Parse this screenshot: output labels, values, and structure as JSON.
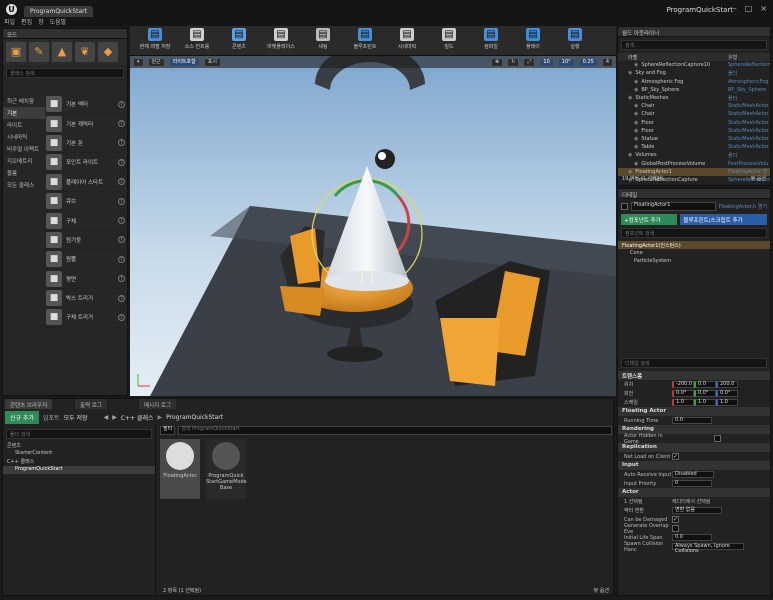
{
  "window": {
    "tabs": [
      "ProgramQuickStart"
    ],
    "project": "ProgramQuickStart",
    "menu": [
      "파일",
      "편집",
      "창",
      "도움말"
    ]
  },
  "modes": {
    "tab": "모드",
    "search_placeholder": "클래스 검색",
    "categories": [
      "최근 배치함",
      "기본",
      "라이트",
      "시네마틱",
      "비주얼 이펙트",
      "지오메트리",
      "볼륨",
      "모든 클래스"
    ],
    "selected_category": "기본",
    "items": [
      {
        "label": "기본 액터",
        "icon": "actor-icon"
      },
      {
        "label": "기본 캐릭터",
        "icon": "character-icon"
      },
      {
        "label": "기본 폰",
        "icon": "pawn-icon"
      },
      {
        "label": "포인트 라이트",
        "icon": "point-light-icon"
      },
      {
        "label": "플레이어 스타트",
        "icon": "player-start-icon"
      },
      {
        "label": "큐브",
        "icon": "cube-icon"
      },
      {
        "label": "구체",
        "icon": "sphere-icon"
      },
      {
        "label": "원기둥",
        "icon": "cylinder-icon"
      },
      {
        "label": "원뿔",
        "icon": "cone-icon"
      },
      {
        "label": "평면",
        "icon": "plane-icon"
      },
      {
        "label": "박스 트리거",
        "icon": "box-trigger-icon"
      },
      {
        "label": "구체 트리거",
        "icon": "sphere-trigger-icon"
      }
    ]
  },
  "toolbar": {
    "buttons": [
      "현재 레벨 저장",
      "소스 컨트롤",
      "콘텐츠",
      "마켓플레이스",
      "세팅",
      "블루프린트",
      "시네마틱",
      "빌드",
      "컴파일",
      "플레이",
      "실행"
    ]
  },
  "viewport": {
    "perspective": "원근",
    "lit": "라이트포함",
    "show": "표시",
    "grid_snap": "10",
    "rot_snap": "10°",
    "scale_snap": "0.25",
    "cam_speed": "4"
  },
  "outliner": {
    "tab": "월드 아웃라이너",
    "search_placeholder": "검색...",
    "col_label": "라벨",
    "col_type": "유형",
    "rows": [
      {
        "n": "SphereReflectionCapture10",
        "t": "SphereReflection",
        "d": 2
      },
      {
        "n": "Sky and Fog",
        "t": "폴더",
        "d": 1
      },
      {
        "n": "Atmospheric Fog",
        "t": "AtmosphericFog",
        "d": 2
      },
      {
        "n": "BP_Sky_Sphere",
        "t": "BP_Sky_Sphere",
        "d": 2
      },
      {
        "n": "StaticMeshes",
        "t": "폴더",
        "d": 1
      },
      {
        "n": "Chair",
        "t": "StaticMeshActor",
        "d": 2
      },
      {
        "n": "Chair",
        "t": "StaticMeshActor",
        "d": 2
      },
      {
        "n": "Floor",
        "t": "StaticMeshActor",
        "d": 2
      },
      {
        "n": "Floor",
        "t": "StaticMeshActor",
        "d": 2
      },
      {
        "n": "Statue",
        "t": "StaticMeshActor",
        "d": 2
      },
      {
        "n": "Table",
        "t": "StaticMeshActor",
        "d": 2
      },
      {
        "n": "Volumes",
        "t": "폴더",
        "d": 1
      },
      {
        "n": "GlobalPostProcessVolume",
        "t": "PostProcessVolu",
        "d": 2
      },
      {
        "n": "FloatingActor1",
        "t": "FloatingActor 편",
        "d": 1,
        "sel": true
      },
      {
        "n": "SphereReflectionCapture",
        "t": "SphereReflection",
        "d": 1
      }
    ],
    "count": "19 액터 (1 선택됨)",
    "view": "뷰 옵션"
  },
  "details": {
    "tab": "디테일",
    "name": "FloatingActor1",
    "bp_link": "FloatingActor.h 열기",
    "add_component": "+컴포넌트 추가",
    "blueprint": "블루프린트/스크립트 추가",
    "search_placeholder": "컴포넌트 검색",
    "components": [
      "FloatingActor1(인스턴스)",
      "Cone",
      "ParticleSystem"
    ],
    "prop_search": "디테일 검색",
    "transform": {
      "label": "트랜스폼",
      "loc": [
        "-200.0",
        "0.0",
        "200.0"
      ],
      "rot": [
        "0.0°",
        "0.0°",
        "0.0°"
      ],
      "scale": [
        "1.0",
        "1.0",
        "1.0"
      ],
      "loc_label": "위치",
      "rot_label": "회전",
      "scale_label": "스케일"
    },
    "sections": [
      "Floating Actor",
      "Rendering",
      "Replication",
      "Input",
      "Actor"
    ],
    "running_time": {
      "l": "Running Time",
      "v": "0.0"
    },
    "hidden": "Actor Hidden in Game",
    "net_load": "Net Load on Client",
    "auto_input": {
      "l": "Auto Receive Input",
      "v": "Disabled"
    },
    "input_priority": {
      "l": "Input Priority",
      "v": "0"
    },
    "selected": {
      "l": "1 선택됨",
      "v": "에디터에서 선택됨"
    },
    "convert": {
      "l": "액터 변환",
      "v": "변환 없음"
    },
    "can_damage": "Can be Damaged",
    "overlap": "Generate Overlap Eve",
    "life": {
      "l": "Initial Life Span",
      "v": "0.0"
    },
    "collision": {
      "l": "Spawn Collision Hanc",
      "v": "Always Spawn, Ignore Collisions"
    }
  },
  "content": {
    "tabs": [
      "콘텐츠 브라우저",
      "출력 로그",
      "메시지 로그"
    ],
    "add_new": "신규 추가",
    "import": "임포트",
    "save_all": "모두 저장",
    "path": [
      "C++ 클래스",
      "ProgramQuickStart"
    ],
    "filter": "필터",
    "search_placeholder": "검색 ProgramQuickStart",
    "tree_search": "폴더 검색",
    "tree": [
      {
        "l": "콘텐츠",
        "d": 0
      },
      {
        "l": "StarterContent",
        "d": 1
      },
      {
        "l": "C++ 클래스",
        "d": 0
      },
      {
        "l": "ProgramQuickStart",
        "d": 1,
        "sel": true
      }
    ],
    "assets": [
      {
        "l": "FloatingActor",
        "icon": "sphere-class-icon",
        "sel": true
      },
      {
        "l": "ProgramQuick StartGameMode Base",
        "icon": "game-mode-icon"
      }
    ],
    "count": "2 항목 (1 선택됨)",
    "view": "뷰 옵션"
  },
  "colors": {
    "accent": "#e8a040",
    "selection": "#5a4a2a",
    "blue": "#2a5ea8",
    "green": "#2e8b57"
  }
}
